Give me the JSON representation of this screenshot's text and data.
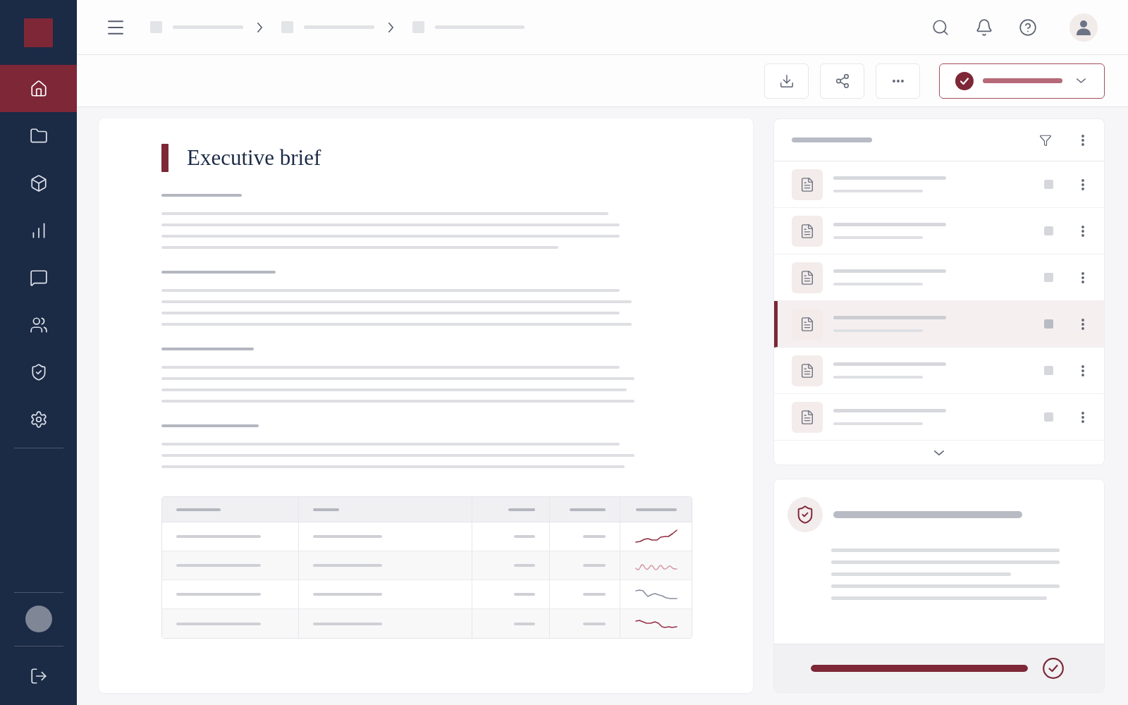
{
  "sidebar": {
    "items": [
      {
        "kind": "home",
        "selected": true
      },
      {
        "kind": "folder",
        "selected": false
      },
      {
        "kind": "box",
        "selected": false
      },
      {
        "kind": "chart",
        "selected": false
      },
      {
        "kind": "chat",
        "selected": false
      },
      {
        "kind": "users",
        "selected": false
      },
      {
        "kind": "shield",
        "selected": false
      },
      {
        "kind": "settings",
        "selected": false
      }
    ]
  },
  "document": {
    "title": "Executive brief",
    "table": {
      "rows": [
        {
          "color": "#8e2b3d"
        },
        {
          "color": "#d79aa6"
        },
        {
          "color": "#8a8f9e"
        },
        {
          "color": "#9b3246"
        }
      ]
    }
  },
  "file_list": {
    "rows": [
      {
        "selected": false
      },
      {
        "selected": false
      },
      {
        "selected": false
      },
      {
        "selected": true
      },
      {
        "selected": false
      },
      {
        "selected": false
      }
    ]
  },
  "security_card": {
    "progress": {
      "level": 1
    }
  }
}
